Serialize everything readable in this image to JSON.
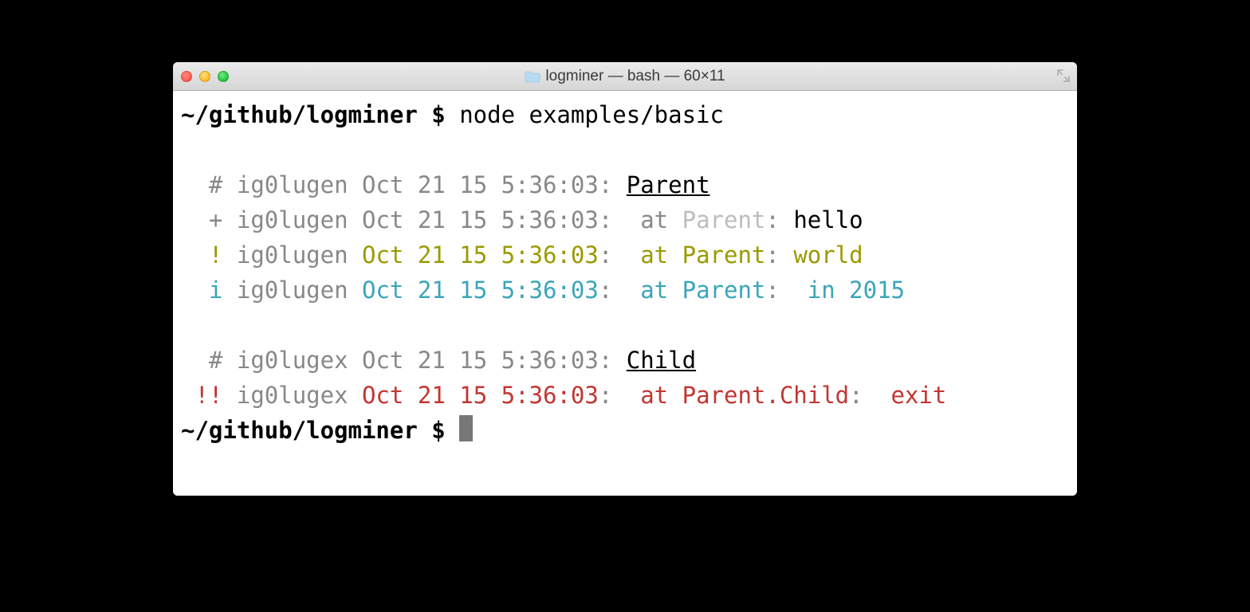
{
  "window": {
    "title": "logminer — bash — 60×11"
  },
  "prompt": {
    "path": "~/github/logminer",
    "symbol": "$"
  },
  "command": "node examples/basic",
  "log": {
    "line1": {
      "indent": "  ",
      "mark": "#",
      "id": "ig0lugen",
      "ts": "Oct 21 15 5:36:03",
      "colon": ":",
      "label": "Parent"
    },
    "line2": {
      "indent": "  ",
      "mark": "+",
      "id": "ig0lugen",
      "ts": "Oct 21 15 5:36:03",
      "colon": ":",
      "at": "at",
      "ctx": "Parent",
      "ctxcolon": ":",
      "msg": "hello"
    },
    "line3": {
      "indent": "  ",
      "mark": "!",
      "id": "ig0lugen",
      "ts": "Oct 21 15 5:36:03",
      "colon": ":",
      "at": "at",
      "ctx": "Parent",
      "ctxcolon": ":",
      "msg": "world"
    },
    "line4": {
      "indent": "  ",
      "mark": "i",
      "id": "ig0lugen",
      "ts": "Oct 21 15 5:36:03",
      "colon": ":",
      "at": "at",
      "ctx": "Parent",
      "ctxcolon": ":",
      "msg": "in 2015"
    },
    "line5": {
      "indent": "  ",
      "mark": "#",
      "id": "ig0lugex",
      "ts": "Oct 21 15 5:36:03",
      "colon": ":",
      "label": "Child"
    },
    "line6": {
      "indent": " ",
      "mark": "!!",
      "id": "ig0lugex",
      "ts": "Oct 21 15 5:36:03",
      "colon": ":",
      "at": "at",
      "ctx": "Parent.Child",
      "ctxcolon": ":",
      "msg": "exit"
    }
  }
}
